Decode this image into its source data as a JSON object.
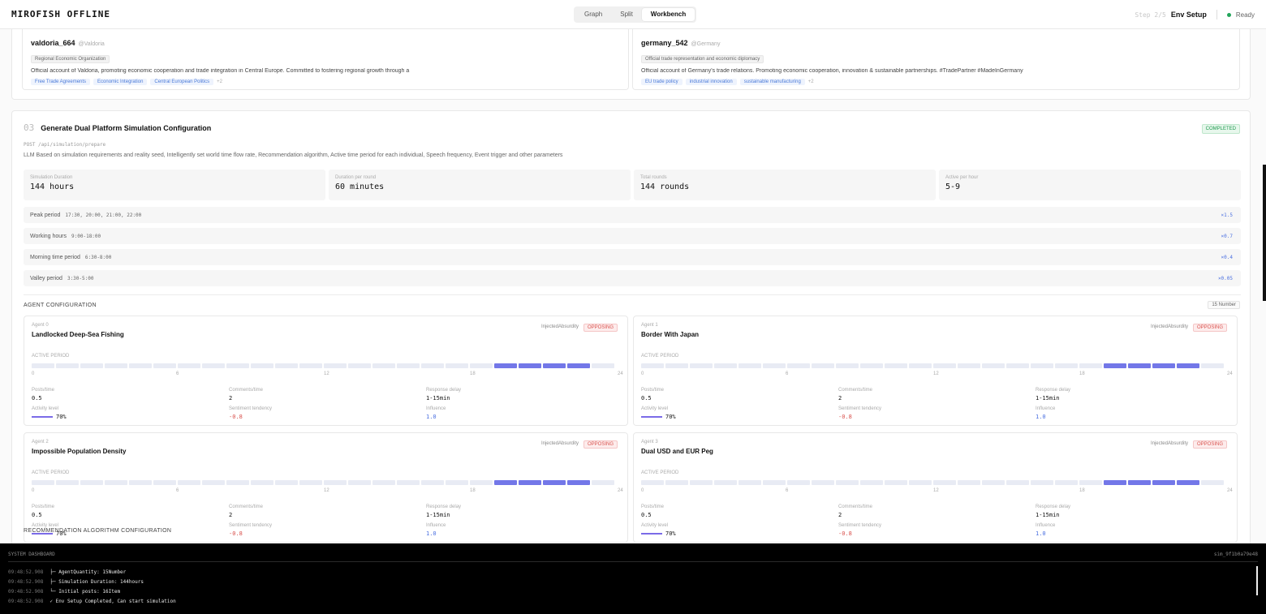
{
  "header": {
    "brand": "MIROFISH OFFLINE",
    "tabs": [
      {
        "label": "Graph",
        "active": false
      },
      {
        "label": "Split",
        "active": false
      },
      {
        "label": "Workbench",
        "active": true
      }
    ],
    "step": "Step 2/5",
    "step_name": "Env Setup",
    "status": "Ready",
    "status_color": "#22a55a"
  },
  "profiles": [
    {
      "username": "valdoria_664",
      "handle": "@Valdoria",
      "role": "Regional Economic Organization",
      "bio": "Official account of Valdoria, promoting economic cooperation and trade integration in Central Europe. Committed to fostering regional growth through a",
      "tags": [
        "Free Trade Agreements",
        "Economic Integration",
        "Central European Politics"
      ],
      "more": "+2"
    },
    {
      "username": "germany_542",
      "handle": "@Germany",
      "role": "Official trade representation and economic diplomacy",
      "bio": "Official account of Germany's trade relations. Promoting economic cooperation, innovation & sustainable partnerships. #TradePartner #MadeInGermany",
      "tags": [
        "EU trade policy",
        "industrial innovation",
        "sustainable manufacturing"
      ],
      "more": "+2"
    }
  ],
  "step03": {
    "num": "03",
    "title": "Generate Dual Platform Simulation Configuration",
    "badge": "COMPLETED",
    "endpoint": "POST /api/simulation/prepare",
    "description": "LLM Based on simulation requirements and reality seed, Intelligently set world time flow rate, Recommendation algorithm, Active time period for each individual, Speech frequency, Event trigger and other parameters",
    "stats": [
      {
        "label": "Simulation Duration",
        "value": "144 hours"
      },
      {
        "label": "Duration per round",
        "value": "60 minutes"
      },
      {
        "label": "Total rounds",
        "value": "144 rounds"
      },
      {
        "label": "Active per hour",
        "value": "5-9"
      }
    ],
    "periods": [
      {
        "label": "Peak period",
        "time": "17:30, 20:00, 21:00, 22:00",
        "mult": "×1.5"
      },
      {
        "label": "Working hours",
        "time": "9:00-18:00",
        "mult": "×0.7"
      },
      {
        "label": "Morning time period",
        "time": "6:30-8:00",
        "mult": "×0.4"
      },
      {
        "label": "Valley period",
        "time": "3:30-5:00",
        "mult": "×0.05"
      }
    ],
    "agent_section": {
      "title": "AGENT CONFIGURATION",
      "count": "15 Number"
    },
    "agents": [
      {
        "id": "Agent 0",
        "name": "Landlocked Deep-Sea Fishing",
        "type": "InjectedAbsurdity",
        "stance": "OPPOSING",
        "active_label": "ACTIVE PERIOD",
        "active_hours": [
          19,
          20,
          21,
          22
        ],
        "ticks": [
          "0",
          "6",
          "12",
          "18",
          "24"
        ],
        "posts_label": "Posts/time",
        "posts": "0.5",
        "comments_label": "Comments/time",
        "comments": "2",
        "delay_label": "Response delay",
        "delay": "1-15min",
        "activity_label": "Activity level",
        "activity": "70%",
        "activity_level": 0.7,
        "sentiment_label": "Sentiment tendency",
        "sentiment": "-0.8",
        "influence_label": "Influence",
        "influence": "1.0"
      },
      {
        "id": "Agent 1",
        "name": "Border With Japan",
        "type": "InjectedAbsurdity",
        "stance": "OPPOSING",
        "active_label": "ACTIVE PERIOD",
        "active_hours": [
          19,
          20,
          21,
          22
        ],
        "ticks": [
          "0",
          "6",
          "12",
          "18",
          "24"
        ],
        "posts_label": "Posts/time",
        "posts": "0.5",
        "comments_label": "Comments/time",
        "comments": "2",
        "delay_label": "Response delay",
        "delay": "1-15min",
        "activity_label": "Activity level",
        "activity": "70%",
        "activity_level": 0.7,
        "sentiment_label": "Sentiment tendency",
        "sentiment": "-0.8",
        "influence_label": "Influence",
        "influence": "1.0"
      },
      {
        "id": "Agent 2",
        "name": "Impossible Population Density",
        "type": "InjectedAbsurdity",
        "stance": "OPPOSING",
        "active_label": "ACTIVE PERIOD",
        "active_hours": [
          19,
          20,
          21,
          22
        ],
        "ticks": [
          "0",
          "6",
          "12",
          "18",
          "24"
        ],
        "posts_label": "Posts/time",
        "posts": "0.5",
        "comments_label": "Comments/time",
        "comments": "2",
        "delay_label": "Response delay",
        "delay": "1-15min",
        "activity_label": "Activity level",
        "activity": "70%",
        "activity_level": 0.7,
        "sentiment_label": "Sentiment tendency",
        "sentiment": "-0.8",
        "influence_label": "Influence",
        "influence": "1.0"
      },
      {
        "id": "Agent 3",
        "name": "Dual USD and EUR Peg",
        "type": "InjectedAbsurdity",
        "stance": "OPPOSING",
        "active_label": "ACTIVE PERIOD",
        "active_hours": [
          19,
          20,
          21,
          22
        ],
        "ticks": [
          "0",
          "6",
          "12",
          "18",
          "24"
        ],
        "posts_label": "Posts/time",
        "posts": "0.5",
        "comments_label": "Comments/time",
        "comments": "2",
        "delay_label": "Response delay",
        "delay": "1-15min",
        "activity_label": "Activity level",
        "activity": "70%",
        "activity_level": 0.7,
        "sentiment_label": "Sentiment tendency",
        "sentiment": "-0.8",
        "influence_label": "Influence",
        "influence": "1.0"
      }
    ],
    "recommendation_title": "RECOMMENDATION ALGORITHM CONFIGURATION"
  },
  "console": {
    "title": "SYSTEM DASHBOARD",
    "session": "sim_9f1b0a79e48",
    "logs": [
      {
        "ts": "09:48:52.908",
        "msg": "├─ AgentQuantity: 15Number"
      },
      {
        "ts": "09:48:52.908",
        "msg": "├─ Simulation Duration: 144hours"
      },
      {
        "ts": "09:48:52.908",
        "msg": "└─ Initial posts: 16Item"
      },
      {
        "ts": "09:48:52.908",
        "msg": "✓ Env Setup Completed, Can start simulation"
      }
    ]
  }
}
